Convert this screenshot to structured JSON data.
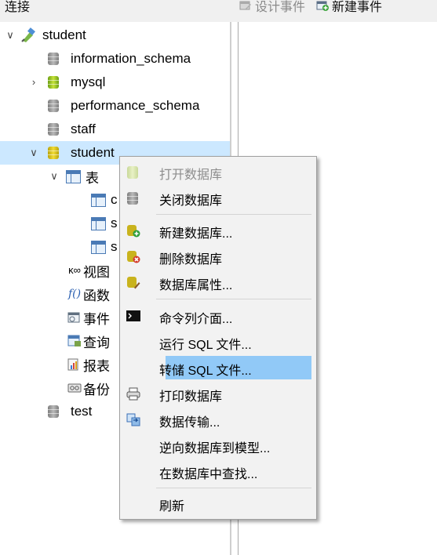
{
  "topbar": {
    "connection_label": "连接",
    "toolbar": [
      {
        "label": "设计事件",
        "enabled": false,
        "icon": "design-event-icon"
      },
      {
        "label": "新建事件",
        "enabled": true,
        "icon": "new-event-icon"
      }
    ]
  },
  "tree": {
    "connection": {
      "label": "student",
      "icon": "connection-icon"
    },
    "databases": [
      {
        "label": "information_schema",
        "state": "closed"
      },
      {
        "label": "mysql",
        "state": "open"
      },
      {
        "label": "performance_schema",
        "state": "closed"
      },
      {
        "label": "staff",
        "state": "closed"
      },
      {
        "label": "student",
        "state": "open",
        "selected": true
      },
      {
        "label": "test",
        "state": "closed"
      }
    ],
    "student_children": [
      {
        "label": "表",
        "icon": "table-folder-icon",
        "expanded": true
      },
      {
        "label": "视图",
        "icon": "view-icon"
      },
      {
        "label": "函数",
        "icon": "function-icon"
      },
      {
        "label": "事件",
        "icon": "event-icon"
      },
      {
        "label": "查询",
        "icon": "query-icon"
      },
      {
        "label": "报表",
        "icon": "report-icon"
      },
      {
        "label": "备份",
        "icon": "backup-icon"
      }
    ],
    "tables": [
      "c",
      "s",
      "s"
    ]
  },
  "context_menu": {
    "items": [
      {
        "label": "打开数据库",
        "enabled": false,
        "icon": "open-database-icon"
      },
      {
        "label": "关闭数据库",
        "enabled": true,
        "icon": "close-database-icon"
      },
      {
        "label": "新建数据库...",
        "enabled": true,
        "icon": "new-database-icon"
      },
      {
        "label": "删除数据库",
        "enabled": true,
        "icon": "delete-database-icon"
      },
      {
        "label": "数据库属性...",
        "enabled": true,
        "icon": "database-properties-icon"
      },
      {
        "label": "命令列介面...",
        "enabled": true,
        "icon": "console-icon"
      },
      {
        "label": "运行 SQL 文件...",
        "enabled": true
      },
      {
        "label": "转储 SQL 文件...",
        "enabled": true,
        "highlighted": true
      },
      {
        "label": "打印数据库",
        "enabled": true,
        "icon": "print-icon"
      },
      {
        "label": "数据传输...",
        "enabled": true,
        "icon": "data-transfer-icon"
      },
      {
        "label": "逆向数据库到模型...",
        "enabled": true
      },
      {
        "label": "在数据库中查找...",
        "enabled": true
      },
      {
        "label": "刷新",
        "enabled": true
      }
    ]
  },
  "colors": {
    "selection": "#cce8ff",
    "menu_highlight": "#91c9f7",
    "open_db": "#c6e23a",
    "closed_db": "#9a9a9a"
  }
}
